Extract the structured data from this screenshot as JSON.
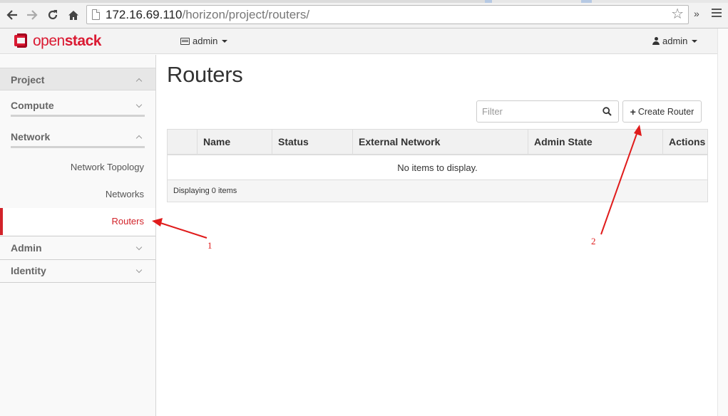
{
  "browser": {
    "url_host": "172.16.69.110",
    "url_path": "/horizon/project/routers/",
    "overflow": "»"
  },
  "topnav": {
    "logo_prefix": "open",
    "logo_suffix": "stack",
    "project": "admin",
    "user": "admin"
  },
  "sidebar": {
    "project": "Project",
    "compute": "Compute",
    "network": "Network",
    "network_items": [
      "Network Topology",
      "Networks",
      "Routers"
    ],
    "admin": "Admin",
    "identity": "Identity"
  },
  "main": {
    "title": "Routers",
    "filter_placeholder": "Filter",
    "create_button": "Create Router",
    "columns": [
      "Name",
      "Status",
      "External Network",
      "Admin State",
      "Actions"
    ],
    "empty_message": "No items to display.",
    "footer": "Displaying 0 items"
  },
  "annotations": [
    "1",
    "2"
  ],
  "colors": {
    "brand": "#da1a32",
    "active": "#d2232a",
    "annotation": "#e01b1b"
  }
}
